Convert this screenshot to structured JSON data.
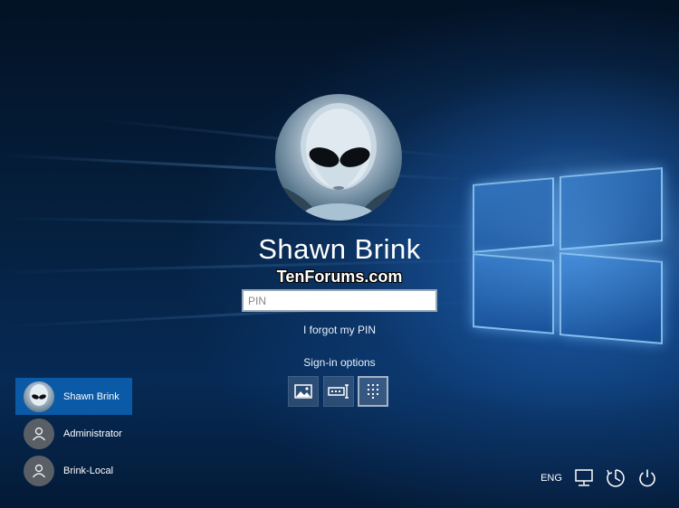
{
  "account": {
    "display_name": "Shawn Brink",
    "pin_placeholder": "PIN",
    "forgot_link": "I forgot my PIN"
  },
  "watermark": "TenForums.com",
  "signin": {
    "label": "Sign-in options",
    "options": [
      {
        "icon": "picture-password-icon",
        "selected": false
      },
      {
        "icon": "password-key-icon",
        "selected": false
      },
      {
        "icon": "pin-keypad-icon",
        "selected": true
      }
    ]
  },
  "users": [
    {
      "name": "Shawn Brink",
      "active": true,
      "avatar": "photo"
    },
    {
      "name": "Administrator",
      "active": false,
      "avatar": "generic"
    },
    {
      "name": "Brink-Local",
      "active": false,
      "avatar": "generic"
    }
  ],
  "tray": {
    "language": "ENG",
    "icons": [
      "network-icon",
      "ease-of-access-icon",
      "power-icon"
    ]
  },
  "colors": {
    "selected_user": "#0a5aa7",
    "background": "#05203f"
  }
}
